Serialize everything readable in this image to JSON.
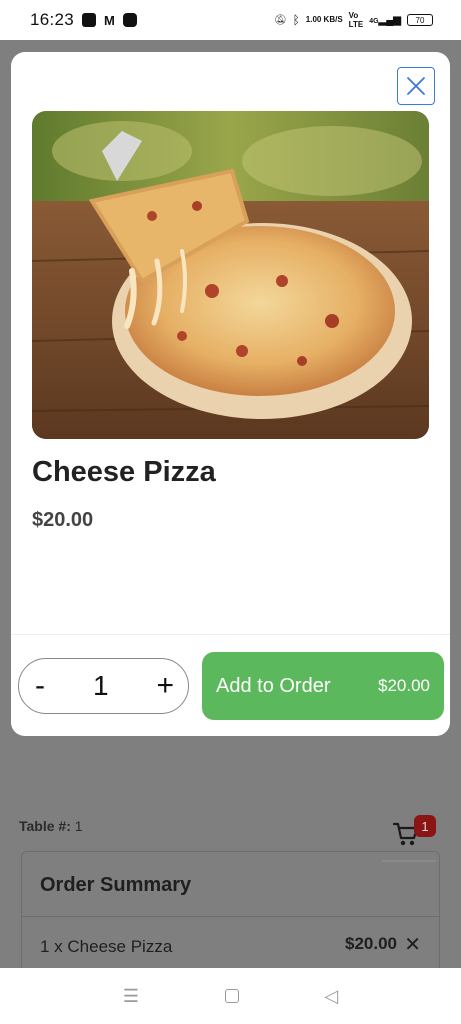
{
  "status_bar": {
    "time": "16:23",
    "speed": "1.00 KB/S",
    "network": "4G",
    "battery": "70",
    "icons": [
      "notification-icon",
      "gmail-icon",
      "app-icon",
      "mute-icon",
      "bluetooth-icon",
      "volte-icon",
      "signal-icon",
      "battery-icon"
    ]
  },
  "modal": {
    "item_name": "Cheese Pizza",
    "item_price": "$20.00",
    "quantity": "1",
    "decrement_label": "-",
    "increment_label": "+",
    "add_button_label": "Add to Order",
    "add_button_price": "$20.00",
    "close_icon": "close-icon",
    "image_subject": "pizza-image"
  },
  "background": {
    "table_label": "Table #:",
    "table_number": "1",
    "cart_count": "1",
    "summary_title": "Order Summary",
    "items": [
      {
        "description": "1 x Cheese Pizza",
        "price": "$20.00",
        "remove": "✕"
      }
    ]
  },
  "nav_bar": {
    "menu": "☰",
    "back": "◁"
  },
  "colors": {
    "accent_green": "#5cb85c",
    "close_blue": "#3a7bd5",
    "badge_red": "#8b1515",
    "overlay_gray": "#7f7f7f"
  }
}
